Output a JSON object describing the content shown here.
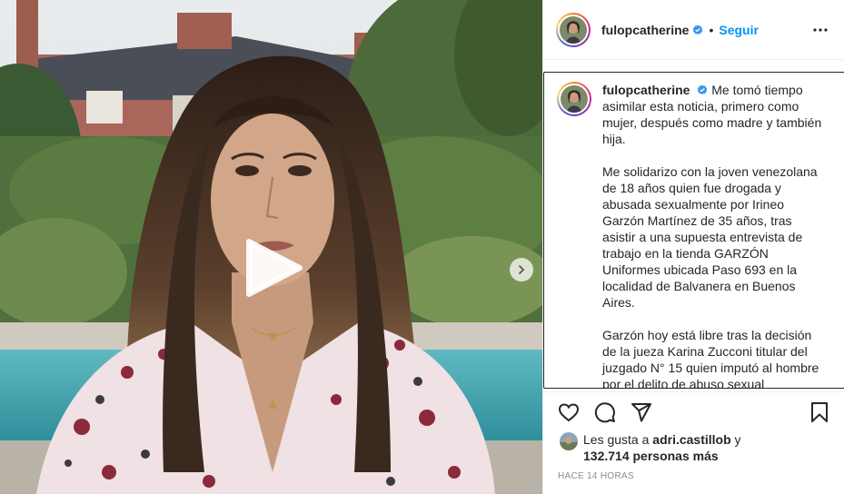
{
  "post": {
    "username": "fulopcatherine",
    "follow_label": "Seguir",
    "separator": "•",
    "caption_paragraphs": [
      "Me tomó tiempo asimilar esta noticia, primero como mujer, después como madre y también hija.",
      "Me solidarizo con la joven venezolana de 18 años quien fue drogada y abusada sexualmente por Irineo Garzón Martínez de 35 años, tras asistir a una supuesta entrevista de trabajo en la tienda GARZÓN Uniformes ubicada Paso 693 en la localidad de Balvanera en Buenos Aires.",
      "Garzón hoy está libre tras la decisión de la jueza Karina Zucconi titular del juzgado N° 15 quien imputó al hombre por el delito de abuso sexual"
    ],
    "likes_prefix": "Les gusta a",
    "likes_user": "adri.castillob",
    "likes_and": "y",
    "likes_count": "132.714 personas más",
    "timestamp": "Hace 14 horas"
  },
  "icons": {
    "more": "more-options-icon",
    "verified": "verified-badge-icon",
    "play": "play-icon",
    "next": "chevron-right-icon",
    "like": "heart-icon",
    "comment": "comment-icon",
    "share": "share-icon",
    "save": "bookmark-icon"
  },
  "colors": {
    "accent": "#0095f6",
    "text": "#262626",
    "muted": "#8e8e8e"
  }
}
